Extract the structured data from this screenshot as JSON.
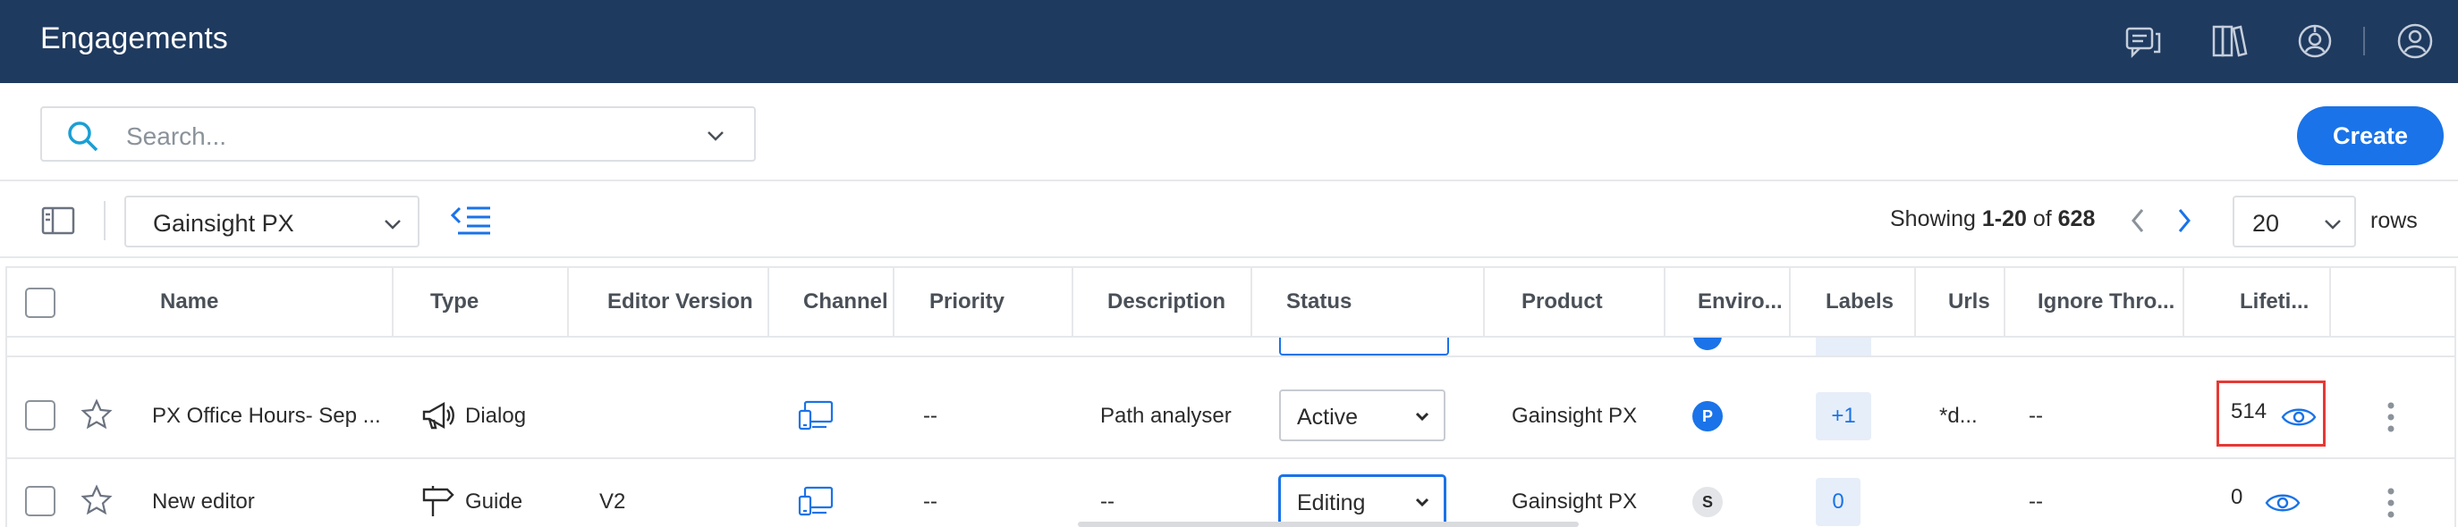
{
  "header": {
    "title": "Engagements",
    "icons": [
      "chat-icon",
      "book-icon",
      "support-icon",
      "user-icon"
    ]
  },
  "search": {
    "placeholder": "Search..."
  },
  "actions": {
    "create_label": "Create"
  },
  "toolbar": {
    "product_value": "Gainsight PX",
    "showing_prefix": "Showing ",
    "showing_range": "1-20",
    "showing_of": " of ",
    "showing_total": "628",
    "rows_value": "20",
    "rows_label": "rows"
  },
  "table": {
    "columns": [
      "Name",
      "Type",
      "Editor Version",
      "Channel",
      "Priority",
      "Description",
      "Status",
      "Product",
      "Enviro...",
      "Labels",
      "Urls",
      "Ignore Thro...",
      "Lifeti..."
    ],
    "rows": [
      {
        "name": "PX Office Hours- Sep ...",
        "type": "Dialog",
        "type_icon": "megaphone-icon",
        "editor_version": "",
        "priority": "--",
        "description": "Path analyser",
        "status": "Active",
        "product": "Gainsight PX",
        "environment": "P",
        "labels": "+1",
        "urls": "*d...",
        "ignore_throttling": "--",
        "lifetime": "514"
      },
      {
        "name": "New editor",
        "type": "Guide",
        "type_icon": "signpost-icon",
        "editor_version": "V2",
        "priority": "--",
        "description": "--",
        "status": "Editing",
        "product": "Gainsight PX",
        "environment": "S",
        "labels": "0",
        "urls": "",
        "ignore_throttling": "--",
        "lifetime": "0"
      }
    ]
  },
  "colors": {
    "header_bg": "#1f3a5f",
    "accent": "#1a73e8",
    "highlight_border": "#e53935"
  }
}
